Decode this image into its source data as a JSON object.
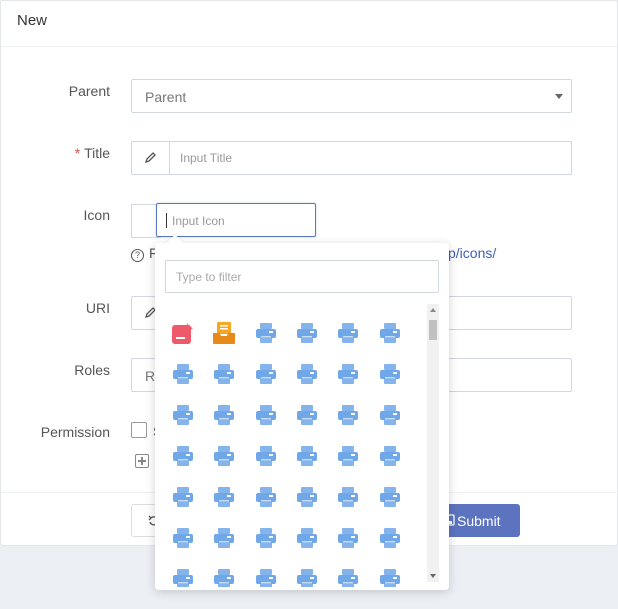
{
  "header": {
    "title": "New"
  },
  "form": {
    "parent": {
      "label": "Parent",
      "placeholder": "Parent"
    },
    "title": {
      "required_mark": "*",
      "label": "Title",
      "placeholder": "Input Title"
    },
    "icon": {
      "label": "Icon",
      "placeholder": "Input Icon",
      "help_prefix": "F",
      "help_link_fragment": "p/icons/"
    },
    "uri": {
      "label": "URI"
    },
    "roles": {
      "label": "Roles",
      "placeholder_fragment": "Ro"
    },
    "permission": {
      "label": "Permission",
      "checkbox_fragment": "S"
    }
  },
  "icon_picker": {
    "filter_placeholder": "Type to filter",
    "columns": 6,
    "rows": 7,
    "icons": [
      "pen-square-icon",
      "inbox-icon",
      "printer-icon",
      "printer-icon",
      "printer-icon",
      "printer-icon"
    ],
    "default_icon": "printer-icon",
    "colors": {
      "printer": "#6fa7e8",
      "pen": "#ef5a6a",
      "inbox": "#f5a623"
    }
  },
  "buttons": {
    "reset_label": "",
    "submit_label": "Submit"
  },
  "colors": {
    "accent": "#5c74bf",
    "link": "#3c5fb5"
  }
}
